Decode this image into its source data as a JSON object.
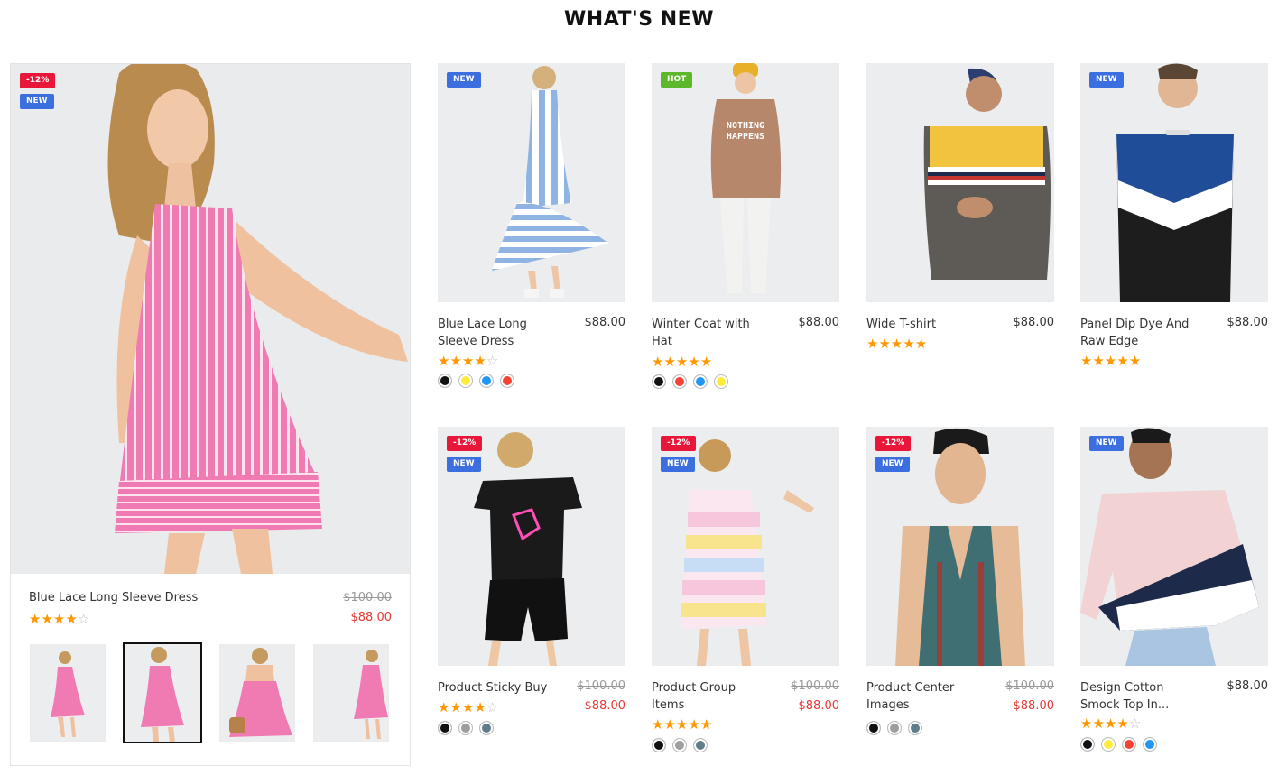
{
  "section": {
    "title": "WHAT'S NEW"
  },
  "colors": {
    "sale_badge": "#e8173a",
    "new_badge": "#3b6fe0",
    "hot_badge": "#5cb82a",
    "star": "#ff9800",
    "sale_price": "#e53935"
  },
  "featured": {
    "badges": [
      "-12%",
      "NEW"
    ],
    "name": "Blue Lace Long Sleeve Dress",
    "old_price": "$100.00",
    "price": "$88.00",
    "rating": 4,
    "thumbnails": [
      "front-view",
      "front-close-view",
      "back-view",
      "side-view"
    ],
    "active_thumbnail": 1
  },
  "products": [
    {
      "name": "Blue Lace Long Sleeve Dress",
      "price": "$88.00",
      "badges": [
        "NEW"
      ],
      "rating": 4,
      "swatches": [
        "#111111",
        "#ffeb3b",
        "#2196f3",
        "#f44336"
      ]
    },
    {
      "name": "Winter Coat with Hat",
      "price": "$88.00",
      "badges": [
        "HOT"
      ],
      "rating": 5,
      "swatches": [
        "#111111",
        "#f44336",
        "#2196f3",
        "#ffeb3b"
      ]
    },
    {
      "name": "Wide T-shirt",
      "price": "$88.00",
      "badges": [],
      "rating": 5,
      "swatches": []
    },
    {
      "name": "Panel Dip Dye And Raw Edge",
      "price": "$88.00",
      "badges": [
        "NEW"
      ],
      "rating": 5,
      "swatches": []
    },
    {
      "name": "Product Sticky Buy",
      "old_price": "$100.00",
      "price": "$88.00",
      "badges": [
        "-12%",
        "NEW"
      ],
      "rating": 4,
      "swatches": [
        "#111111",
        "#9e9e9e",
        "#607d8b"
      ]
    },
    {
      "name": "Product Group Items",
      "old_price": "$100.00",
      "price": "$88.00",
      "badges": [
        "-12%",
        "NEW"
      ],
      "rating": 5,
      "swatches": [
        "#111111",
        "#9e9e9e",
        "#607d8b"
      ]
    },
    {
      "name": "Product Center Images",
      "old_price": "$100.00",
      "price": "$88.00",
      "badges": [
        "-12%",
        "NEW"
      ],
      "rating": 0,
      "swatches": [
        "#111111",
        "#9e9e9e",
        "#607d8b"
      ]
    },
    {
      "name": "Design Cotton Smock Top In...",
      "price": "$88.00",
      "badges": [
        "NEW"
      ],
      "rating": 4,
      "swatches": [
        "#111111",
        "#ffeb3b",
        "#f44336",
        "#2196f3"
      ]
    }
  ]
}
